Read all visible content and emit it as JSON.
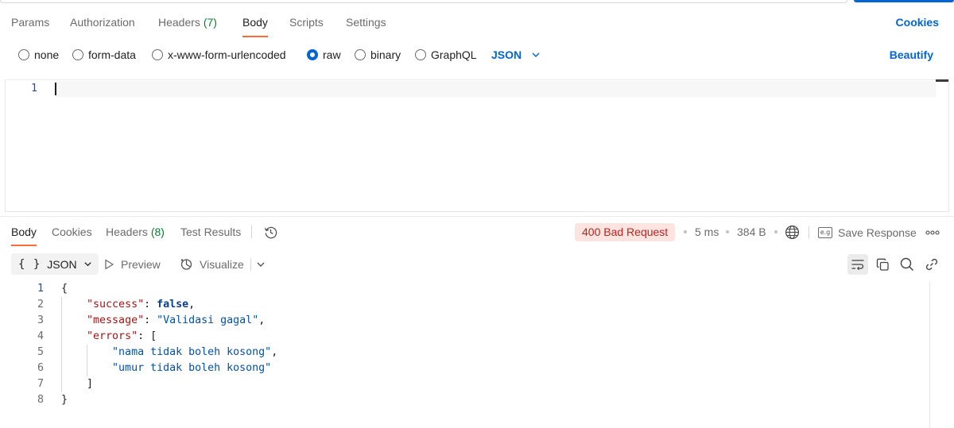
{
  "request": {
    "tabs": [
      {
        "label": "Params"
      },
      {
        "label": "Authorization"
      },
      {
        "label": "Headers",
        "count": "(7)"
      },
      {
        "label": "Body"
      },
      {
        "label": "Scripts"
      },
      {
        "label": "Settings"
      }
    ],
    "active_tab": "Body",
    "cookies_label": "Cookies",
    "body_types": [
      "none",
      "form-data",
      "x-www-form-urlencoded",
      "raw",
      "binary",
      "GraphQL"
    ],
    "selected_body_type": "raw",
    "language": "JSON",
    "beautify_label": "Beautify",
    "editor": {
      "line_numbers": [
        "1"
      ],
      "content": ""
    }
  },
  "response": {
    "tabs": [
      {
        "label": "Body"
      },
      {
        "label": "Cookies"
      },
      {
        "label": "Headers",
        "count": "(8)"
      },
      {
        "label": "Test Results"
      }
    ],
    "active_tab": "Body",
    "status": "400 Bad Request",
    "time": "5 ms",
    "size": "384 B",
    "save_label": "Save Response",
    "save_icon_text": "e.g",
    "format_braces": "{ }",
    "format_label": "JSON",
    "preview_label": "Preview",
    "visualize_label": "Visualize",
    "line_numbers": [
      "1",
      "2",
      "3",
      "4",
      "5",
      "6",
      "7",
      "8"
    ],
    "json": {
      "open_brace": "{",
      "close_brace": "}",
      "success_key": "\"success\"",
      "success_value": "false",
      "message_key": "\"message\"",
      "message_value": "\"Validasi gagal\"",
      "errors_key": "\"errors\"",
      "open_bracket": "[",
      "close_bracket": "]",
      "errors": [
        "\"nama tidak boleh kosong\"",
        "\"umur tidak boleh kosong\""
      ]
    }
  },
  "colors": {
    "accent_orange": "#ff6c37",
    "link_blue": "#0265d2",
    "status_bg": "#fde4e0",
    "status_text": "#b3261e",
    "count_green": "#0a7d2f"
  }
}
